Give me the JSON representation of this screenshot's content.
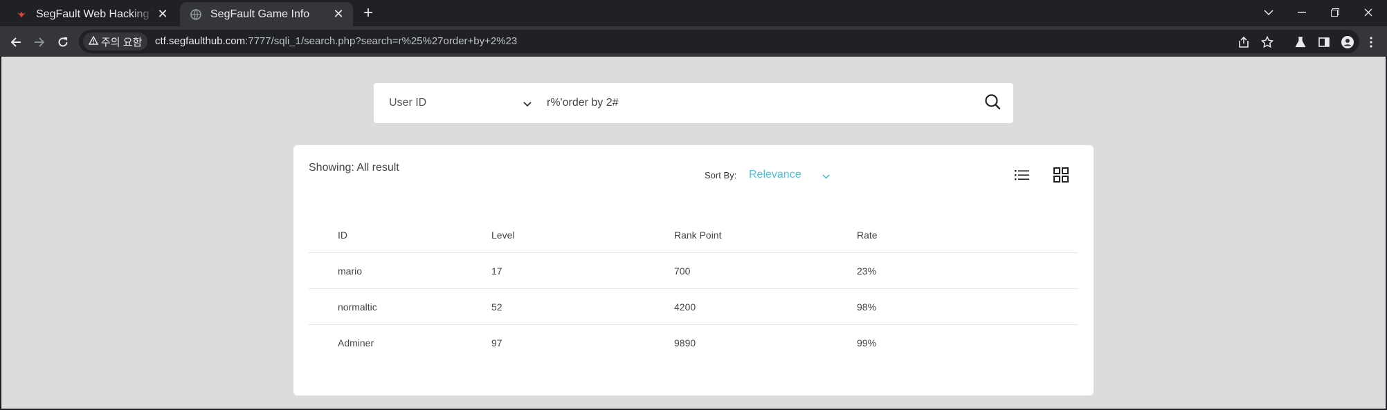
{
  "browser": {
    "tabs": [
      {
        "title": "SegFault Web Hacking Trai",
        "active": false,
        "favicon": "segfault-logo-icon"
      },
      {
        "title": "SegFault Game Info",
        "active": true,
        "favicon": "globe-icon"
      }
    ],
    "security_label": "주의 요함",
    "url_host": "ctf.segfaulthub.com",
    "url_rest": ":7777/sqli_1/search.php?search=r%25%27order+by+2%23"
  },
  "search": {
    "type_label": "User ID",
    "query": "r%'order by 2#"
  },
  "results": {
    "showing_label": "Showing: All result",
    "sort_by_label": "Sort By:",
    "sort_by_value": "Relevance",
    "columns": [
      "ID",
      "Level",
      "Rank Point",
      "Rate"
    ],
    "rows": [
      [
        "mario",
        "17",
        "700",
        "23%"
      ],
      [
        "normaltic",
        "52",
        "4200",
        "98%"
      ],
      [
        "Adminer",
        "97",
        "9890",
        "99%"
      ]
    ]
  },
  "colors": {
    "accent": "#4ec0d8",
    "page_bg": "#dcdcdc",
    "chrome_bg": "#202124",
    "toolbar_bg": "#35363a"
  }
}
